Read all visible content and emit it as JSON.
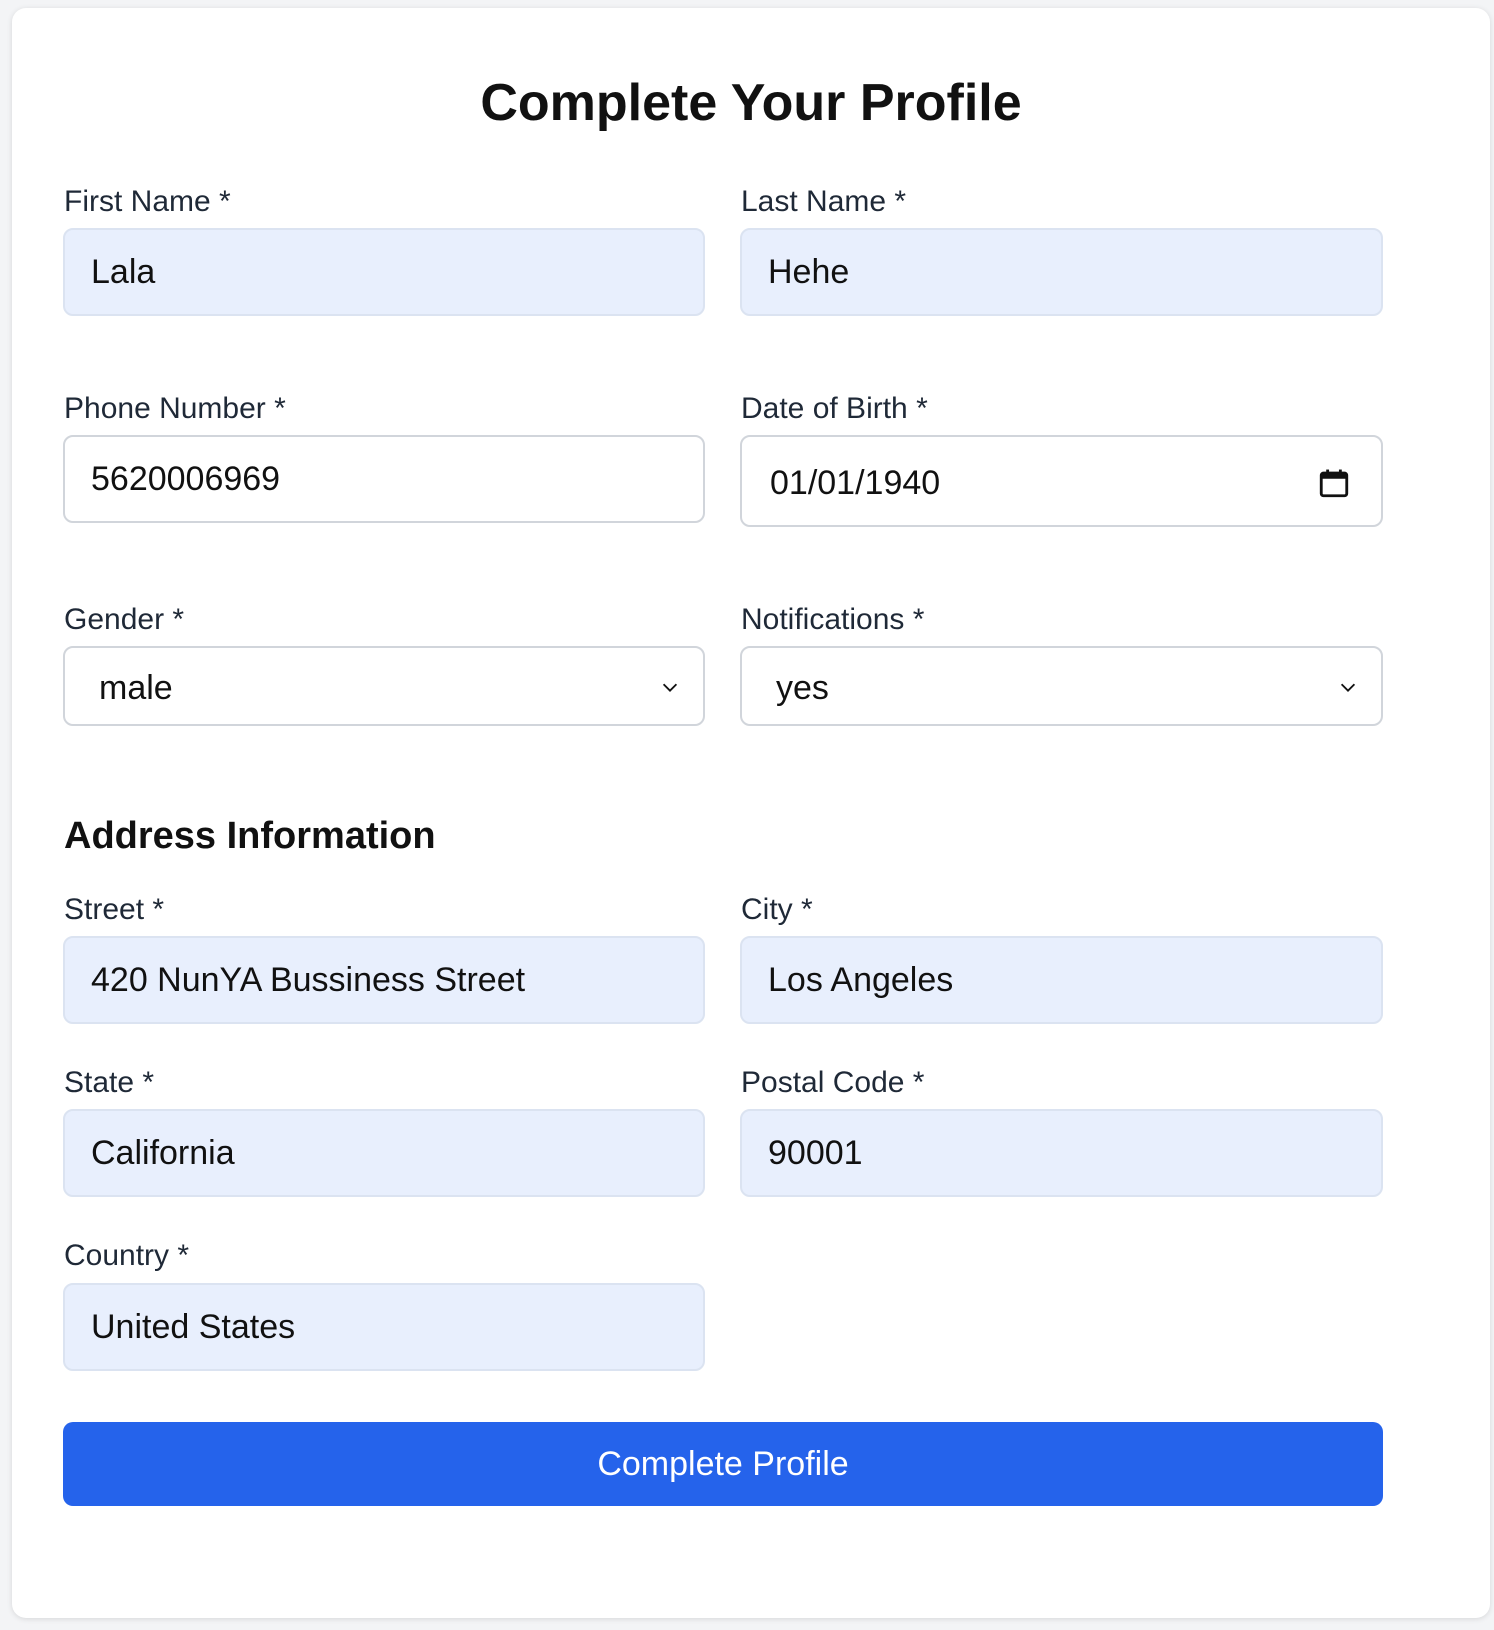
{
  "page": {
    "title": "Complete Your Profile"
  },
  "fields": {
    "first_name": {
      "label": "First Name *",
      "value": "Lala"
    },
    "last_name": {
      "label": "Last Name *",
      "value": "Hehe"
    },
    "phone": {
      "label": "Phone Number *",
      "value": "5620006969"
    },
    "dob": {
      "label": "Date of Birth *",
      "value": "01/01/1940",
      "icon": "calendar-icon"
    },
    "gender": {
      "label": "Gender *",
      "value": "male",
      "icon": "chevron-down-icon"
    },
    "notifications": {
      "label": "Notifications *",
      "value": "yes",
      "icon": "chevron-down-icon"
    }
  },
  "address": {
    "heading": "Address Information",
    "street": {
      "label": "Street *",
      "value": "420 NunYA Bussiness Street"
    },
    "city": {
      "label": "City *",
      "value": "Los Angeles"
    },
    "state": {
      "label": "State *",
      "value": "California"
    },
    "postal_code": {
      "label": "Postal Code *",
      "value": "90001"
    },
    "country": {
      "label": "Country *",
      "value": "United States"
    }
  },
  "actions": {
    "submit_label": "Complete Profile"
  },
  "colors": {
    "primary": "#2563eb",
    "autofill_bg": "#e8effd",
    "border": "#d1d5db"
  }
}
